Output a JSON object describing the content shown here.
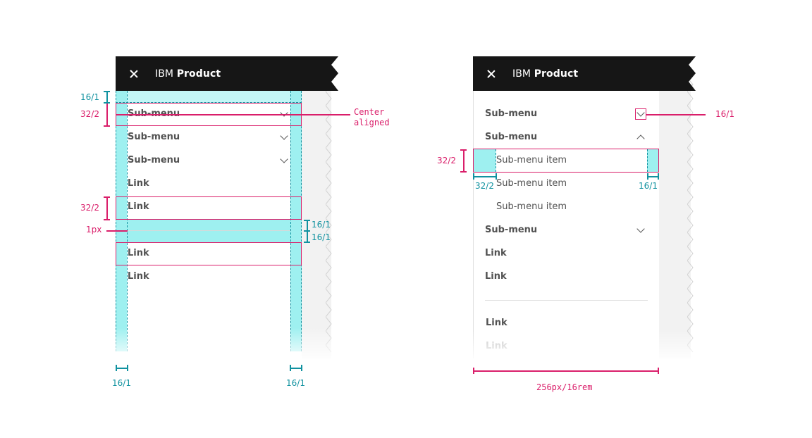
{
  "colors": {
    "header_bg": "#161616",
    "spec_pink": "#da1e6a",
    "spec_teal": "#1192a0",
    "padding_cyan": "#9ef0f0",
    "backdrop_grey": "#f2f2f2"
  },
  "left_panel": {
    "header": {
      "close_icon": "close-icon",
      "brand": "IBM",
      "product": "Product"
    },
    "items": [
      {
        "label": "Sub-menu",
        "type": "submenu",
        "chevron": "down"
      },
      {
        "label": "Sub-menu",
        "type": "submenu",
        "chevron": "down"
      },
      {
        "label": "Sub-menu",
        "type": "submenu",
        "chevron": "down"
      },
      {
        "label": "Link",
        "type": "link"
      },
      {
        "label": "Link",
        "type": "link"
      },
      {
        "label": "Link",
        "type": "link"
      },
      {
        "label": "Link",
        "type": "link"
      }
    ],
    "annotations": {
      "top_padding": "16/1",
      "item_height": "32/2",
      "center_aligned": [
        "Center",
        "aligned"
      ],
      "link_height": "32/2",
      "divider": "1px",
      "divider_space_top": "16/1",
      "divider_space_bottom": "16/1",
      "left_padding": "16/1",
      "right_padding": "16/1"
    }
  },
  "right_panel": {
    "header": {
      "close_icon": "close-icon",
      "brand": "IBM",
      "product": "Product"
    },
    "items": [
      {
        "label": "Sub-menu",
        "type": "submenu",
        "chevron": "down"
      },
      {
        "label": "Sub-menu",
        "type": "submenu",
        "chevron": "up"
      },
      {
        "label": "Sub-menu item",
        "type": "submenu-item"
      },
      {
        "label": "Sub-menu item",
        "type": "submenu-item"
      },
      {
        "label": "Sub-menu item",
        "type": "submenu-item"
      },
      {
        "label": "Sub-menu",
        "type": "submenu",
        "chevron": "down"
      },
      {
        "label": "Link",
        "type": "link"
      },
      {
        "label": "Link",
        "type": "link"
      },
      {
        "label": "Link",
        "type": "link"
      },
      {
        "label": "Link",
        "type": "link",
        "faded": true
      }
    ],
    "annotations": {
      "chevron_size": "16/1",
      "item_height": "32/2",
      "item_left_indent": "32/2",
      "item_right_padding": "16/1",
      "panel_width": "256px/16rem"
    }
  }
}
